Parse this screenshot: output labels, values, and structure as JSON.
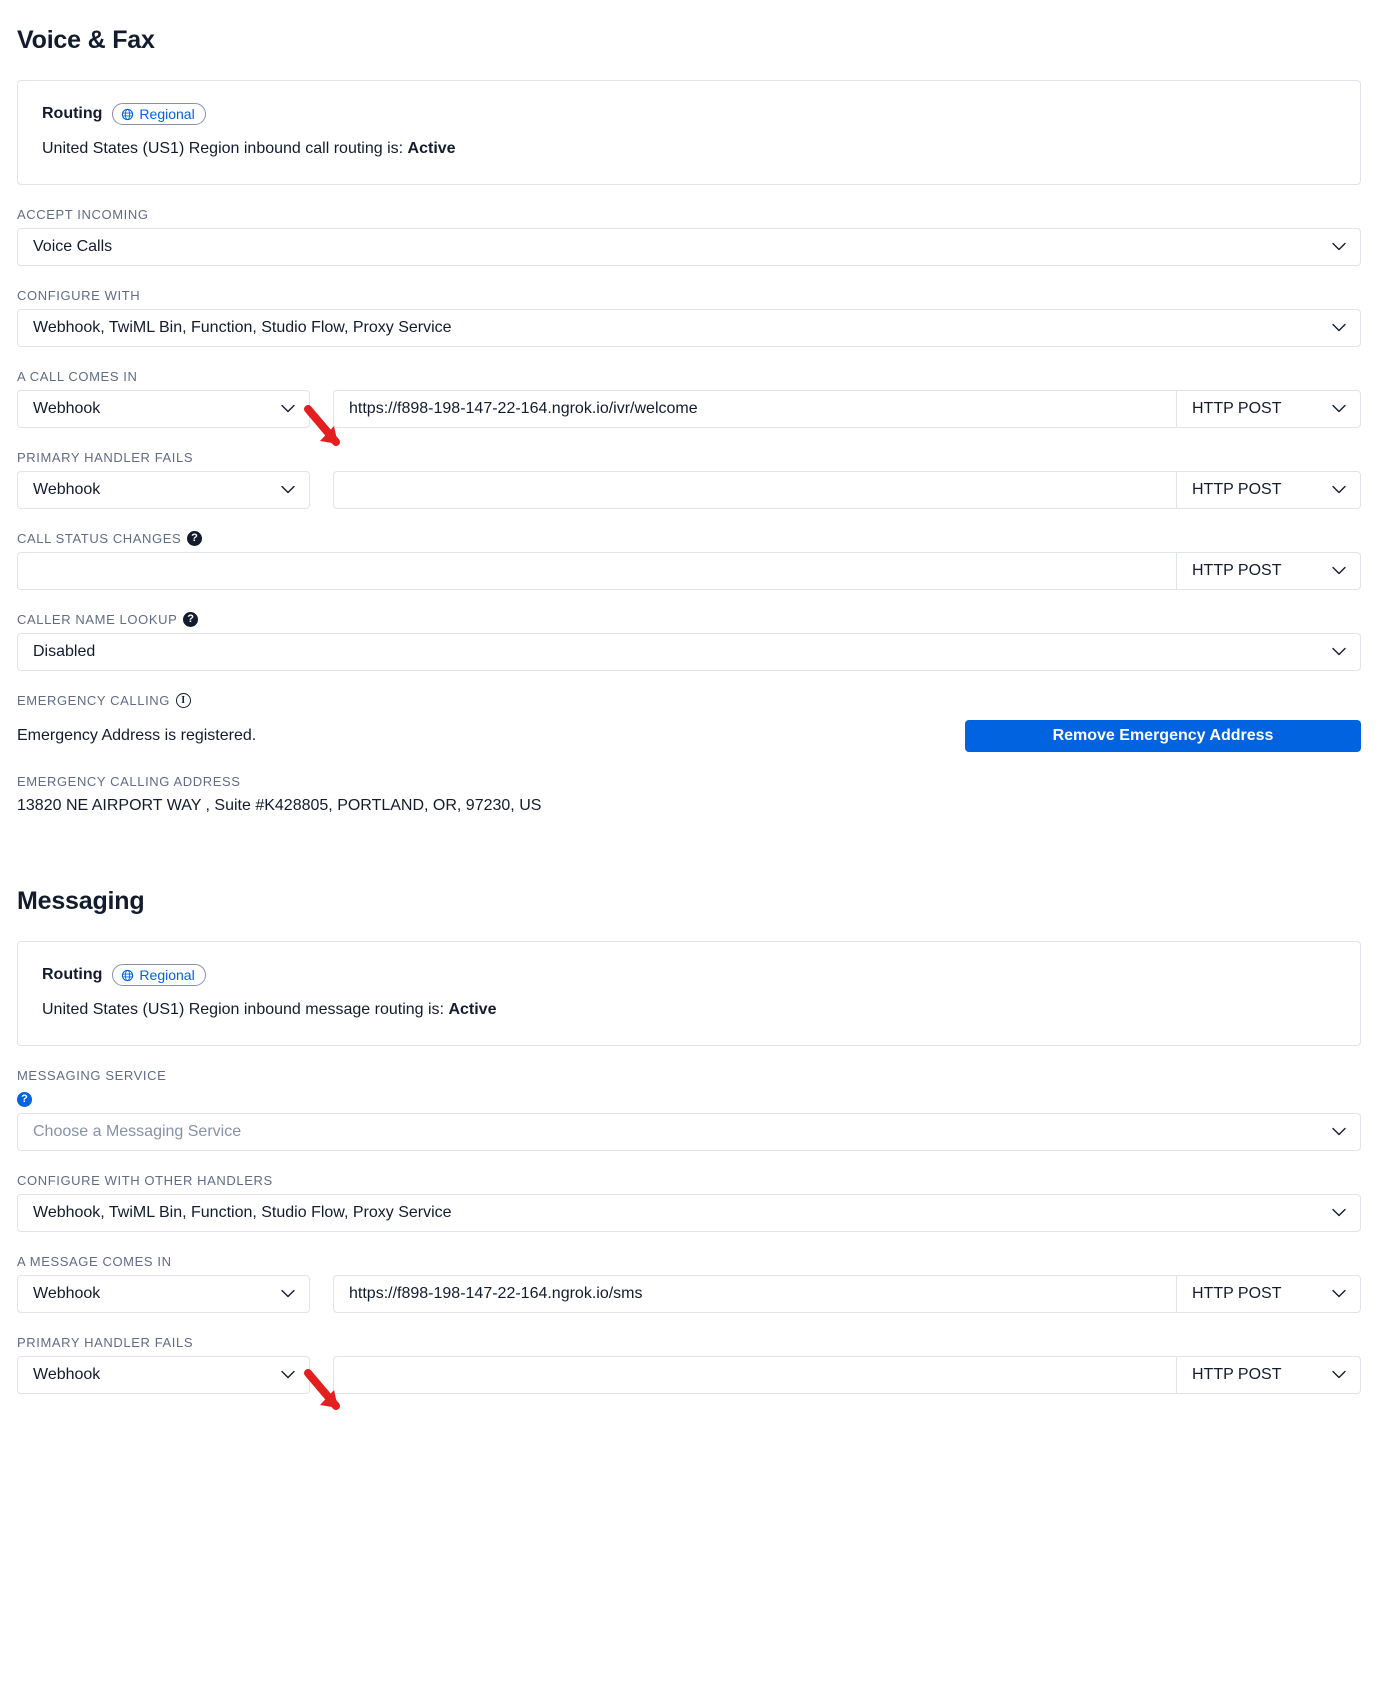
{
  "voice": {
    "title": "Voice & Fax",
    "routing": {
      "label": "Routing",
      "badge": "Regional",
      "badge_icon": "globe-icon",
      "description_prefix": "United States (US1) Region inbound call routing is: ",
      "status": "Active"
    },
    "accept_incoming": {
      "label": "ACCEPT INCOMING",
      "value": "Voice Calls"
    },
    "configure_with": {
      "label": "CONFIGURE WITH",
      "value": "Webhook, TwiML Bin, Function, Studio Flow, Proxy Service"
    },
    "a_call_comes_in": {
      "label": "A CALL COMES IN",
      "handler": "Webhook",
      "url": "https://f898-198-147-22-164.ngrok.io/ivr/welcome",
      "method": "HTTP POST"
    },
    "primary_handler_fails": {
      "label": "PRIMARY HANDLER FAILS",
      "handler": "Webhook",
      "url": "",
      "method": "HTTP POST"
    },
    "call_status_changes": {
      "label": "CALL STATUS CHANGES",
      "help_icon": "help-icon",
      "url": "",
      "method": "HTTP POST"
    },
    "caller_name_lookup": {
      "label": "CALLER NAME LOOKUP",
      "help_icon": "help-icon",
      "value": "Disabled"
    },
    "emergency_calling": {
      "label": "EMERGENCY CALLING",
      "info_icon": "info-icon",
      "status_text": "Emergency Address is registered.",
      "remove_button": "Remove Emergency Address"
    },
    "emergency_address": {
      "label": "EMERGENCY CALLING ADDRESS",
      "value": "13820 NE AIRPORT WAY , Suite #K428805, PORTLAND, OR, 97230, US"
    }
  },
  "messaging": {
    "title": "Messaging",
    "routing": {
      "label": "Routing",
      "badge": "Regional",
      "badge_icon": "globe-icon",
      "description_prefix": "United States (US1) Region inbound message routing is: ",
      "status": "Active"
    },
    "messaging_service": {
      "label": "MESSAGING SERVICE",
      "help_icon": "help-icon",
      "placeholder": "Choose a Messaging Service"
    },
    "configure_with_other_handlers": {
      "label": "CONFIGURE WITH OTHER HANDLERS",
      "value": "Webhook, TwiML Bin, Function, Studio Flow, Proxy Service"
    },
    "a_message_comes_in": {
      "label": "A MESSAGE COMES IN",
      "handler": "Webhook",
      "url": "https://f898-198-147-22-164.ngrok.io/sms",
      "method": "HTTP POST"
    },
    "primary_handler_fails": {
      "label": "PRIMARY HANDLER FAILS",
      "handler": "Webhook",
      "url": "",
      "method": "HTTP POST"
    }
  },
  "annotations": {
    "arrow_color": "#e3201f",
    "arrow_voice_name": "arrow-pointing-to-voice-url",
    "arrow_message_name": "arrow-pointing-to-message-url"
  },
  "colors": {
    "accent": "#0263e0",
    "text": "#121c2d",
    "muted": "#606b85",
    "border": "#e1e3ea",
    "arrow": "#e3201f"
  }
}
